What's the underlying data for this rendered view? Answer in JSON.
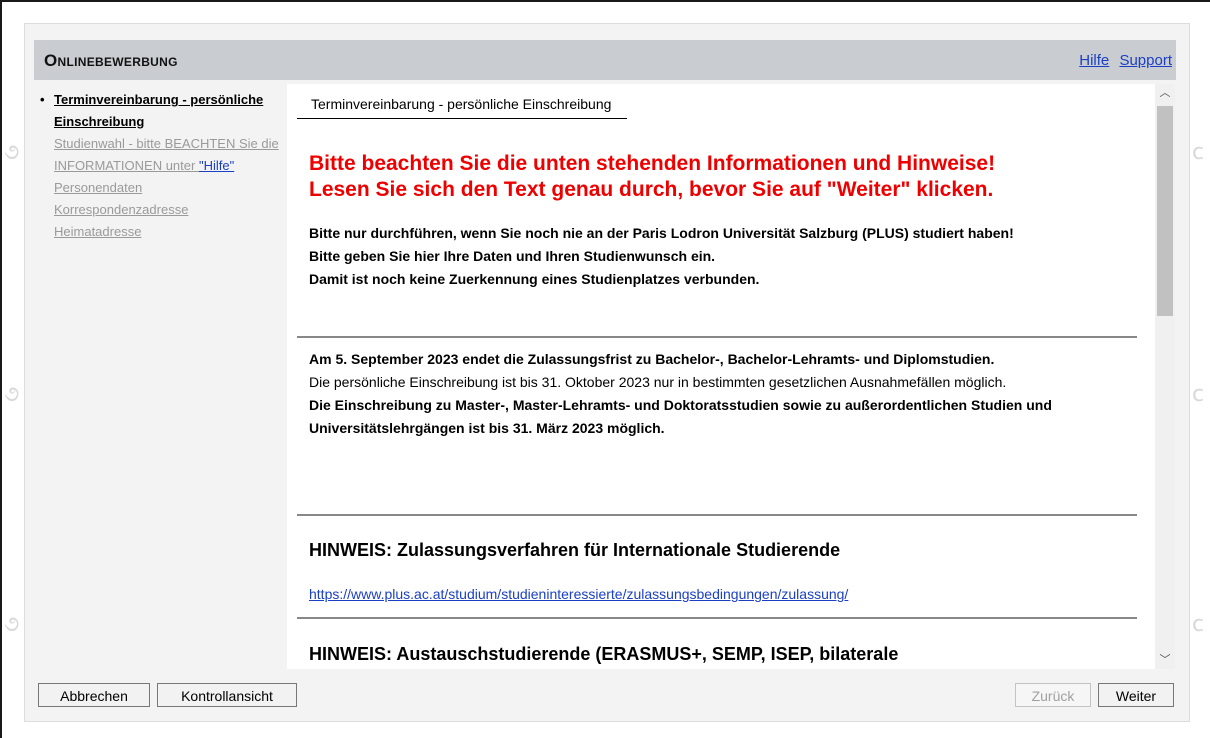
{
  "header": {
    "title": "Onlinebewerbung",
    "links": [
      "Hilfe",
      "Support"
    ]
  },
  "sidebar": {
    "steps": [
      {
        "label": "Terminvereinbarung - persönliche Einschreibung",
        "active": true
      },
      {
        "label": "Studienwahl - bitte BEACHTEN Sie die INFORMATIONEN unter ",
        "link": "\"Hilfe\"",
        "active": false
      },
      {
        "label": "Personendaten",
        "active": false
      },
      {
        "label": "Korrespondenzadresse",
        "active": false
      },
      {
        "label": "Heimatadresse",
        "active": false
      }
    ]
  },
  "content": {
    "tab": "Terminvereinbarung - persönliche Einschreibung",
    "red_line1": "Bitte beachten Sie die unten stehenden Informationen und Hinweise!",
    "red_line2": "Lesen Sie sich den Text genau durch, bevor Sie auf \"Weiter\" klicken.",
    "p1_line1": "Bitte nur durchführen, wenn Sie noch nie an der Paris Lodron Universität Salzburg (PLUS) studiert haben!",
    "p1_line2": "Bitte geben Sie hier Ihre Daten und Ihren Studienwunsch ein.",
    "p1_line3": "Damit ist noch keine Zuerkennung eines Studienplatzes verbunden.",
    "p2_bold": "Am 5. September 2023 endet die Zulassungsfrist zu Bachelor-, Bachelor-Lehramts- und Diplomstudien.",
    "p2_normal": "Die persönliche Einschreibung ist bis 31. Oktober 2023 nur in bestimmten gesetzlichen Ausnahmefällen möglich.",
    "p2_bold2": "Die Einschreibung zu Master-, Master-Lehramts- und Doktoratsstudien sowie zu außerordentlichen Studien und Universitätslehrgängen ist bis 31. März 2023 möglich.",
    "hinweis1": "HINWEIS: Zulassungsverfahren für Internationale Studierende",
    "link1": "https://www.plus.ac.at/studium/studieninteressierte/zulassungsbedingungen/zulassung/",
    "hinweis2": "HINWEIS: Austauschstudierende (ERASMUS+, SEMP, ISEP, bilaterale"
  },
  "buttons": {
    "cancel": "Abbrechen",
    "control_view": "Kontrollansicht",
    "back": "Zurück",
    "next": "Weiter"
  }
}
